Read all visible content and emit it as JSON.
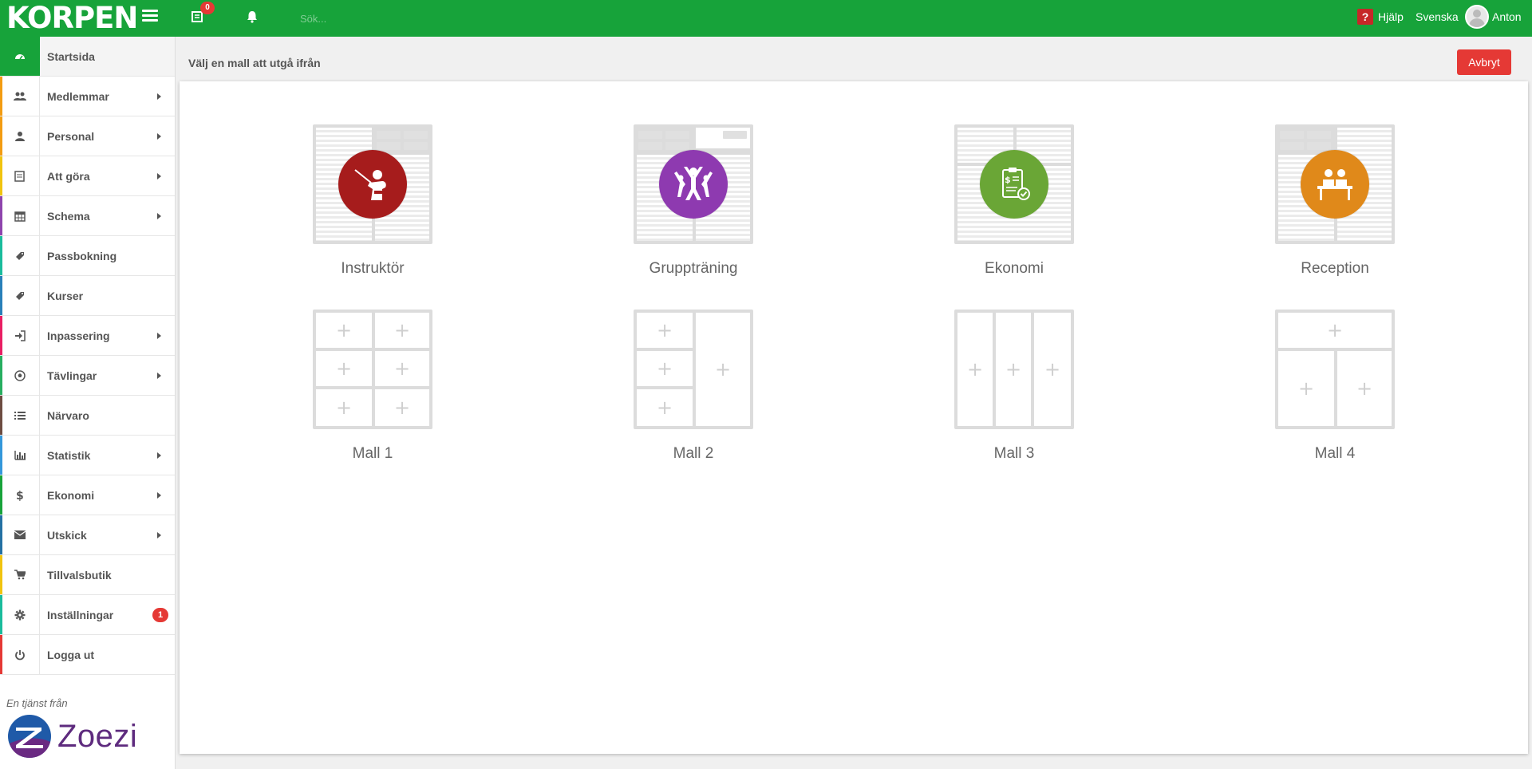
{
  "header": {
    "logo_text": "KORPEN",
    "inbox_badge": "0",
    "search_placeholder": "Sök...",
    "help_label": "Hjälp",
    "language_label": "Svenska",
    "user_name": "Anton",
    "brand_color": "#17a33a"
  },
  "sidebar": {
    "items": [
      {
        "label": "Startsida",
        "icon": "dashboard-icon",
        "stripe": "#17a33a"
      },
      {
        "label": "Medlemmar",
        "icon": "users-icon",
        "stripe": "#f39c12"
      },
      {
        "label": "Personal",
        "icon": "user-icon",
        "stripe": "#f39c12"
      },
      {
        "label": "Att göra",
        "icon": "todo-icon",
        "stripe": "#f1c40f"
      },
      {
        "label": "Schema",
        "icon": "calendar-icon",
        "stripe": "#8e44ad"
      },
      {
        "label": "Passbokning",
        "icon": "ticket-icon",
        "stripe": "#1abc9c"
      },
      {
        "label": "Kurser",
        "icon": "ticket-icon",
        "stripe": "#2980b9"
      },
      {
        "label": "Inpassering",
        "icon": "sign-in-icon",
        "stripe": "#e91e63"
      },
      {
        "label": "Tävlingar",
        "icon": "soccer-ball-icon",
        "stripe": "#27ae60"
      },
      {
        "label": "Närvaro",
        "icon": "list-icon",
        "stripe": "#6d4c41"
      },
      {
        "label": "Statistik",
        "icon": "bar-chart-icon",
        "stripe": "#3498db"
      },
      {
        "label": "Ekonomi",
        "icon": "dollar-icon",
        "stripe": "#17a33a"
      },
      {
        "label": "Utskick",
        "icon": "envelope-icon",
        "stripe": "#2471a3"
      },
      {
        "label": "Tillvalsbutik",
        "icon": "cart-icon",
        "stripe": "#f1c40f"
      },
      {
        "label": "Inställningar",
        "icon": "gear-icon",
        "stripe": "#1abc9c",
        "badge": "1"
      },
      {
        "label": "Logga ut",
        "icon": "power-icon",
        "stripe": "#e53935"
      }
    ],
    "brand_text": "En tjänst från",
    "brand_name": "Zoezi"
  },
  "main": {
    "subheader": "Välj en mall att utgå ifrån",
    "cancel_label": "Avbryt",
    "templates": [
      {
        "label": "Instruktör",
        "color": "#a61c1c",
        "icon": "instructor-icon"
      },
      {
        "label": "Gruppträning",
        "color": "#8e3ab0",
        "icon": "group-training-icon"
      },
      {
        "label": "Ekonomi",
        "color": "#6aa636",
        "icon": "finance-icon"
      },
      {
        "label": "Reception",
        "color": "#e0891a",
        "icon": "reception-icon"
      },
      {
        "label": "Mall 1"
      },
      {
        "label": "Mall 2"
      },
      {
        "label": "Mall 3"
      },
      {
        "label": "Mall 4"
      }
    ]
  }
}
